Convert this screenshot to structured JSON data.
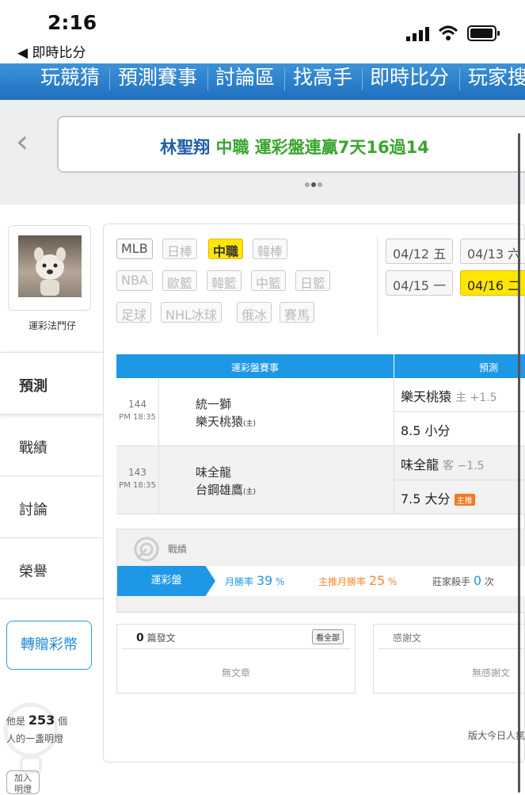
{
  "status_bar": {
    "time": "2:16",
    "back_label": "◀ 即時比分"
  },
  "top_nav": {
    "items": [
      "玩競猜",
      "預測賽事",
      "討論區",
      "找高手",
      "即時比分",
      "玩家搜"
    ]
  },
  "banner": {
    "name": "林聖翔",
    "league": "中職",
    "text": "運彩盤連贏7天16過14"
  },
  "profile": {
    "username": "運彩法鬥仔"
  },
  "side_menu": {
    "items": [
      "預測",
      "戰績",
      "討論",
      "榮譽"
    ],
    "active": "預測"
  },
  "gift_button": "轉贈彩幣",
  "lamp": {
    "prefix": "他是",
    "count": "253",
    "suffix": "個",
    "line2": "人的一盞明燈"
  },
  "join_button": "加入\n明燈",
  "sports": {
    "row1": [
      "MLB",
      "日棒",
      "中職",
      "韓棒"
    ],
    "row2": [
      "NBA",
      "歐籃",
      "韓籃",
      "中籃",
      "日籃"
    ],
    "row3": [
      "足球",
      "NHL冰球",
      "俄冰",
      "賽馬"
    ],
    "selected": "中職"
  },
  "dates": [
    {
      "date": "04/12",
      "day": "五"
    },
    {
      "date": "04/13",
      "day": "六"
    },
    {
      "date": "04/15",
      "day": "一"
    },
    {
      "date": "04/16",
      "day": "二"
    }
  ],
  "table": {
    "header_left": "運彩盤賽事",
    "header_right": "預測",
    "games": [
      {
        "num": "144",
        "time": "PM 18:35",
        "team1": "統一獅",
        "team2": "樂天桃猿",
        "host_mark": "(主)",
        "pick1_team": "樂天桃猿",
        "pick1_side": "主 +1.5",
        "pick2": "8.5 小分",
        "pick2_tag": ""
      },
      {
        "num": "143",
        "time": "PM 18:35",
        "team1": "味全龍",
        "team2": "台鋼雄鷹",
        "host_mark": "(主)",
        "pick1_team": "味全龍",
        "pick1_side": "客 −1.5",
        "pick2": "7.5 大分",
        "pick2_tag": "主推"
      }
    ]
  },
  "record": {
    "title": "戰績",
    "tab": "運彩盤",
    "monthly_label": "月勝率",
    "monthly_value": "39",
    "monthly_unit": "%",
    "main_label": "主推月勝率",
    "main_value": "25",
    "main_unit": "%",
    "killer_label": "莊家殺手",
    "killer_value": "0",
    "killer_unit": "次"
  },
  "posts": {
    "count": "0",
    "label": "篇發文",
    "view_all": "看全部",
    "empty": "無文章"
  },
  "thanks": {
    "label": "感謝文",
    "empty": "無感謝文"
  },
  "footer_text": "版大今日人氣"
}
